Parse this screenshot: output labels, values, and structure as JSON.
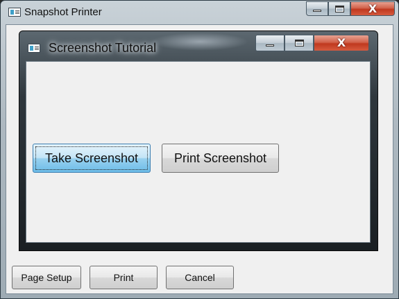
{
  "outer_window": {
    "title": "Snapshot Printer",
    "icon": "app-window-icon",
    "controls": [
      "minimize-icon",
      "maximize-icon",
      "close-icon"
    ],
    "close_glyph": "X"
  },
  "inner_window": {
    "title": "Screenshot Tutorial",
    "icon": "app-window-icon",
    "controls": [
      "minimize-icon",
      "maximize-icon",
      "close-icon"
    ],
    "close_glyph": "X",
    "buttons": {
      "take_screenshot": "Take Screenshot",
      "print_screenshot": "Print Screenshot"
    }
  },
  "footer": {
    "page_setup": "Page Setup",
    "print": "Print",
    "cancel": "Cancel"
  },
  "colors": {
    "close_red": "#c0391f",
    "focused_button": "#6cbce8",
    "client_background": "#f0f0f0"
  }
}
